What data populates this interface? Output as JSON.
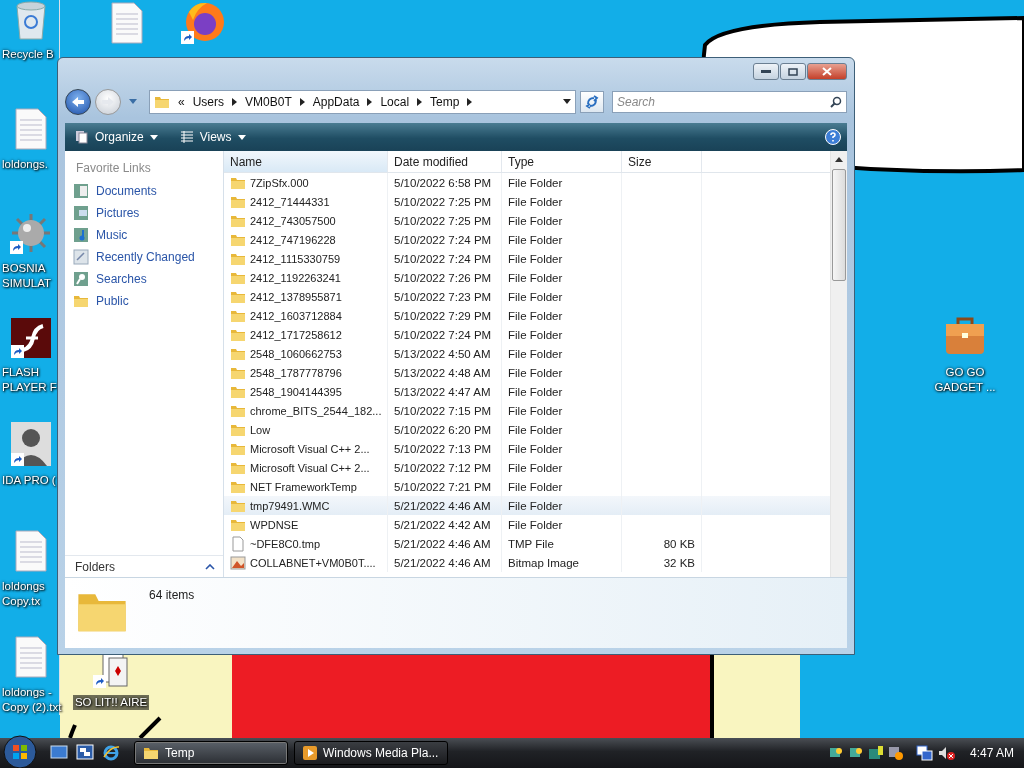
{
  "desktop_icons": [
    {
      "kind": "recycle",
      "label": "Recycle B"
    },
    {
      "kind": "text"
    },
    {
      "kind": "flame"
    },
    {
      "kind": "text",
      "label": "loldongs."
    },
    {
      "kind": "mine",
      "label": "BOSNIA\nSIMULAT"
    },
    {
      "kind": "flash",
      "label": "FLASH\nPLAYER F"
    },
    {
      "kind": "portrait",
      "label": "IDA PRO ("
    },
    {
      "kind": "text",
      "label": "loldongs\nCopy.tx"
    },
    {
      "kind": "text",
      "label": "loldongs -\nCopy (2).txt"
    },
    {
      "kind": "cards",
      "label": "SO LIT!! AIRE"
    },
    {
      "kind": "briefcase",
      "label": "GO GO\nGADGET ..."
    }
  ],
  "explorer": {
    "breadcrumb": [
      "«",
      "Users",
      "VM0B0T",
      "AppData",
      "Local",
      "Temp"
    ],
    "search": {
      "placeholder": "Search"
    },
    "toolbar": [
      "Organize",
      "Views"
    ],
    "favorite_links": {
      "title": "Favorite Links",
      "items": [
        {
          "kind": "documents",
          "label": "Documents"
        },
        {
          "kind": "pictures",
          "label": "Pictures"
        },
        {
          "kind": "music",
          "label": "Music"
        },
        {
          "kind": "recent",
          "label": "Recently Changed"
        },
        {
          "kind": "searches",
          "label": "Searches"
        },
        {
          "kind": "folder",
          "label": "Public"
        }
      ]
    },
    "folders_bar": "Folders",
    "columns": [
      "Name",
      "Date modified",
      "Type",
      "Size"
    ],
    "rows": [
      {
        "kind": "folder",
        "name": "7ZipSfx.000",
        "date": "5/10/2022 6:58 PM",
        "type": "File Folder",
        "size": "",
        "selected": false
      },
      {
        "kind": "folder",
        "name": "2412_71444331",
        "date": "5/10/2022 7:25 PM",
        "type": "File Folder",
        "size": "",
        "selected": false
      },
      {
        "kind": "folder",
        "name": "2412_743057500",
        "date": "5/10/2022 7:25 PM",
        "type": "File Folder",
        "size": "",
        "selected": false
      },
      {
        "kind": "folder",
        "name": "2412_747196228",
        "date": "5/10/2022 7:24 PM",
        "type": "File Folder",
        "size": "",
        "selected": false
      },
      {
        "kind": "folder",
        "name": "2412_1115330759",
        "date": "5/10/2022 7:24 PM",
        "type": "File Folder",
        "size": "",
        "selected": false
      },
      {
        "kind": "folder",
        "name": "2412_1192263241",
        "date": "5/10/2022 7:26 PM",
        "type": "File Folder",
        "size": "",
        "selected": false
      },
      {
        "kind": "folder",
        "name": "2412_1378955871",
        "date": "5/10/2022 7:23 PM",
        "type": "File Folder",
        "size": "",
        "selected": false
      },
      {
        "kind": "folder",
        "name": "2412_1603712884",
        "date": "5/10/2022 7:29 PM",
        "type": "File Folder",
        "size": "",
        "selected": false
      },
      {
        "kind": "folder",
        "name": "2412_1717258612",
        "date": "5/10/2022 7:24 PM",
        "type": "File Folder",
        "size": "",
        "selected": false
      },
      {
        "kind": "folder",
        "name": "2548_1060662753",
        "date": "5/13/2022 4:50 AM",
        "type": "File Folder",
        "size": "",
        "selected": false
      },
      {
        "kind": "folder",
        "name": "2548_1787778796",
        "date": "5/13/2022 4:48 AM",
        "type": "File Folder",
        "size": "",
        "selected": false
      },
      {
        "kind": "folder",
        "name": "2548_1904144395",
        "date": "5/13/2022 4:47 AM",
        "type": "File Folder",
        "size": "",
        "selected": false
      },
      {
        "kind": "folder",
        "name": "chrome_BITS_2544_182...",
        "date": "5/10/2022 7:15 PM",
        "type": "File Folder",
        "size": "",
        "selected": false
      },
      {
        "kind": "folder",
        "name": "Low",
        "date": "5/10/2022 6:20 PM",
        "type": "File Folder",
        "size": "",
        "selected": false
      },
      {
        "kind": "folder",
        "name": "Microsoft Visual C++ 2...",
        "date": "5/10/2022 7:13 PM",
        "type": "File Folder",
        "size": "",
        "selected": false
      },
      {
        "kind": "folder",
        "name": "Microsoft Visual C++ 2...",
        "date": "5/10/2022 7:12 PM",
        "type": "File Folder",
        "size": "",
        "selected": false
      },
      {
        "kind": "folder",
        "name": "NET FrameworkTemp",
        "date": "5/10/2022 7:21 PM",
        "type": "File Folder",
        "size": "",
        "selected": false
      },
      {
        "kind": "folder",
        "name": "tmp79491.WMC",
        "date": "5/21/2022 4:46 AM",
        "type": "File Folder",
        "size": "",
        "selected": true
      },
      {
        "kind": "folder",
        "name": "WPDNSE",
        "date": "5/21/2022 4:42 AM",
        "type": "File Folder",
        "size": "",
        "selected": false
      },
      {
        "kind": "file",
        "name": "~DFE8C0.tmp",
        "date": "5/21/2022 4:46 AM",
        "type": "TMP File",
        "size": "80 KB",
        "selected": false
      },
      {
        "kind": "image",
        "name": "COLLABNET+VM0B0T....",
        "date": "5/21/2022 4:46 AM",
        "type": "Bitmap Image",
        "size": "32 KB",
        "selected": false
      }
    ],
    "item_count": "64 items"
  },
  "taskbar": {
    "buttons": [
      {
        "kind": "folder",
        "label": "Temp",
        "selected": true
      },
      {
        "kind": "media",
        "label": "Windows Media Pla...",
        "selected": false
      }
    ],
    "clock": "4:47 AM"
  }
}
